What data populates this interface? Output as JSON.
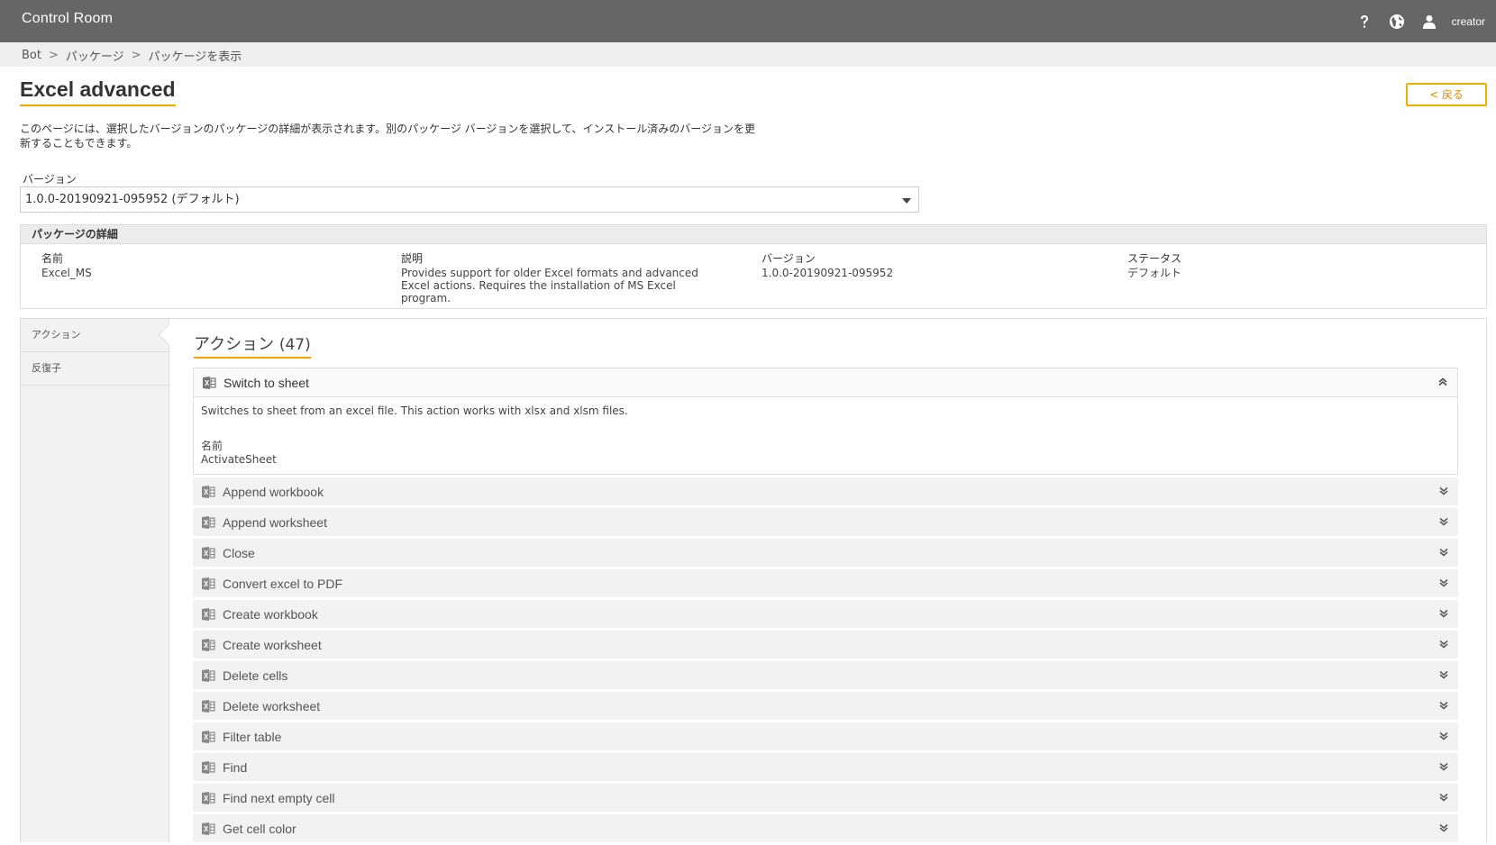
{
  "app": {
    "title": "Control Room",
    "username": "creator"
  },
  "breadcrumb": [
    {
      "label": "Bot"
    },
    {
      "label": "パッケージ"
    },
    {
      "label": "パッケージを表示"
    }
  ],
  "page": {
    "title": "Excel advanced",
    "back_label": "< 戻る",
    "description": "このページには、選択したバージョンのパッケージの詳細が表示されます。別のパッケージ バージョンを選択して、インストール済みのバージョンを更新することもできます。"
  },
  "version_select": {
    "label": "バージョン",
    "value": "1.0.0-20190921-095952 (デフォルト)"
  },
  "details": {
    "heading": "パッケージの詳細",
    "name_label": "名前",
    "name_value": "Excel_MS",
    "desc_label": "説明",
    "desc_value": "Provides support for older Excel formats and advanced Excel actions. Requires the installation of MS Excel program.",
    "version_label": "バージョン",
    "version_value": "1.0.0-20190921-095952",
    "status_label": "ステータス",
    "status_value": "デフォルト"
  },
  "sidebar": {
    "items": [
      {
        "label": "アクション"
      },
      {
        "label": "反復子"
      }
    ]
  },
  "actions": {
    "title": "アクション",
    "count": "(47)",
    "expanded": {
      "name": "Switch to sheet",
      "description": "Switches to sheet from an excel file. This action works with xlsx and xlsm files.",
      "name_label": "名前",
      "name_value": "ActivateSheet"
    },
    "items": [
      {
        "name": "Append workbook"
      },
      {
        "name": "Append worksheet"
      },
      {
        "name": "Close"
      },
      {
        "name": "Convert excel to PDF"
      },
      {
        "name": "Create workbook"
      },
      {
        "name": "Create worksheet"
      },
      {
        "name": "Delete cells"
      },
      {
        "name": "Delete worksheet"
      },
      {
        "name": "Filter table"
      },
      {
        "name": "Find"
      },
      {
        "name": "Find next empty cell"
      },
      {
        "name": "Get cell color"
      }
    ]
  },
  "colors": {
    "topbar": "#666666",
    "accent": "#f0a500"
  }
}
